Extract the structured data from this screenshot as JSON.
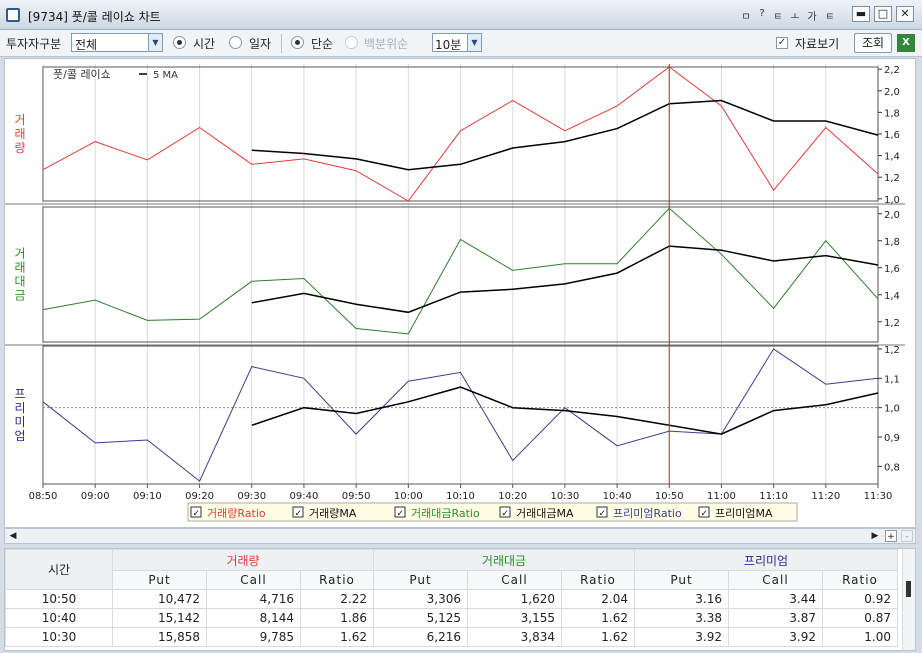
{
  "window": {
    "title": "[9734]  풋/콜 레이쇼 차트",
    "icons": [
      "pin-icon",
      "help-icon",
      "layout-icon",
      "link-icon",
      "font-icon",
      "settings-icon"
    ],
    "icon_glyphs": [
      "ㅁ",
      "?",
      "ㅌ",
      "ㅗ",
      "가",
      "ㅌ"
    ],
    "controls": [
      "minimize-icon",
      "maximize-icon",
      "close-icon"
    ]
  },
  "toolbar": {
    "investor_label": "투자자구분",
    "investor_value": "전체",
    "time_label": "시간",
    "date_label": "일자",
    "simple_label": "단순",
    "percent_label": "백분위순",
    "period_value": "10분",
    "show_data_label": "자료보기",
    "query_label": "조회",
    "excel_label": "X"
  },
  "chart_data": {
    "type": "line",
    "x": [
      "08:50",
      "09:00",
      "09:10",
      "09:20",
      "09:30",
      "09:40",
      "09:50",
      "10:00",
      "10:10",
      "10:20",
      "10:30",
      "10:40",
      "10:50",
      "11:00",
      "11:10",
      "11:20",
      "11:30"
    ],
    "cursor_x": "10:50",
    "panels": [
      {
        "ylabel": "거래량",
        "ylabel_color": "#e03c3c",
        "ylim": [
          0.98,
          2.22
        ],
        "ticks": [
          "1,0",
          "1,2",
          "1,4",
          "1,6",
          "1,8",
          "2,0",
          "2,2"
        ],
        "tick_values": [
          1.0,
          1.2,
          1.4,
          1.6,
          1.8,
          2.0,
          2.2
        ],
        "legend": {
          "title": "풋/콜 레이쇼",
          "ma_label": "5 MA"
        },
        "series": [
          {
            "name": "거래량Ratio",
            "color": "#e03c3c",
            "values": [
              1.27,
              1.53,
              1.36,
              1.66,
              1.32,
              1.37,
              1.26,
              0.98,
              1.63,
              1.91,
              1.63,
              1.86,
              2.22,
              1.86,
              1.08,
              1.66,
              1.23
            ]
          },
          {
            "name": "거래량MA",
            "color": "#000000",
            "values": [
              null,
              null,
              null,
              null,
              1.45,
              1.42,
              1.37,
              1.27,
              1.32,
              1.47,
              1.53,
              1.65,
              1.88,
              1.91,
              1.72,
              1.72,
              1.59
            ]
          }
        ]
      },
      {
        "ylabel": "거래대금",
        "ylabel_color": "#2e8b2e",
        "ylim": [
          1.05,
          2.05
        ],
        "ticks": [
          "1,2",
          "1,4",
          "1,6",
          "1,8",
          "2,0"
        ],
        "tick_values": [
          1.2,
          1.4,
          1.6,
          1.8,
          2.0
        ],
        "series": [
          {
            "name": "거래대금Ratio",
            "color": "#2e7d2e",
            "values": [
              1.29,
              1.36,
              1.21,
              1.22,
              1.5,
              1.52,
              1.15,
              1.11,
              1.81,
              1.58,
              1.63,
              1.63,
              2.04,
              1.7,
              1.3,
              1.8,
              1.37
            ]
          },
          {
            "name": "거래대금MA",
            "color": "#000000",
            "values": [
              null,
              null,
              null,
              null,
              1.34,
              1.41,
              1.33,
              1.27,
              1.42,
              1.44,
              1.48,
              1.56,
              1.76,
              1.73,
              1.65,
              1.69,
              1.62
            ]
          }
        ]
      },
      {
        "ylabel": "프리미엄",
        "ylabel_color": "#2a2a8a",
        "ylim": [
          0.74,
          1.21
        ],
        "ticks": [
          "0,8",
          "0,9",
          "1,0",
          "1,1",
          "1,2"
        ],
        "tick_values": [
          0.8,
          0.9,
          1.0,
          1.1,
          1.2
        ],
        "series": [
          {
            "name": "프리미엄Ratio",
            "color": "#3c3c8c",
            "values": [
              1.02,
              0.88,
              0.89,
              0.75,
              1.14,
              1.1,
              0.91,
              1.09,
              1.12,
              0.82,
              1.0,
              0.87,
              0.92,
              0.91,
              1.2,
              1.08,
              1.1
            ]
          },
          {
            "name": "프리미엄MA",
            "color": "#000000",
            "values": [
              null,
              null,
              null,
              null,
              0.94,
              1.0,
              0.98,
              1.02,
              1.07,
              1.0,
              0.99,
              0.97,
              0.94,
              0.91,
              0.99,
              1.01,
              1.05
            ]
          }
        ]
      }
    ],
    "legend_items": [
      "거래량Ratio",
      "거래량MA",
      "거래대금Ratio",
      "거래대금MA",
      "프리미엄Ratio",
      "프리미엄MA"
    ],
    "legend_colors": [
      "#e03c3c",
      "#111111",
      "#2e8b2e",
      "#111111",
      "#3c3c8c",
      "#111111"
    ]
  },
  "table": {
    "time_header": "시간",
    "groups": [
      {
        "label": "거래량",
        "color": "#e03c3c"
      },
      {
        "label": "거래대금",
        "color": "#2e8b2e"
      },
      {
        "label": "프리미엄",
        "color": "#2a2a8a"
      }
    ],
    "subheaders": [
      "Put",
      "Call",
      "Ratio",
      "Put",
      "Call",
      "Ratio",
      "Put",
      "Call",
      "Ratio"
    ],
    "rows": [
      [
        "10:50",
        "10,472",
        "4,716",
        "2.22",
        "3,306",
        "1,620",
        "2.04",
        "3.16",
        "3.44",
        "0.92"
      ],
      [
        "10:40",
        "15,142",
        "8,144",
        "1.86",
        "5,125",
        "3,155",
        "1.62",
        "3.38",
        "3.87",
        "0.87"
      ],
      [
        "10:30",
        "15,858",
        "9,785",
        "1.62",
        "6,216",
        "3,834",
        "1.62",
        "3.92",
        "3.92",
        "1.00"
      ]
    ]
  }
}
